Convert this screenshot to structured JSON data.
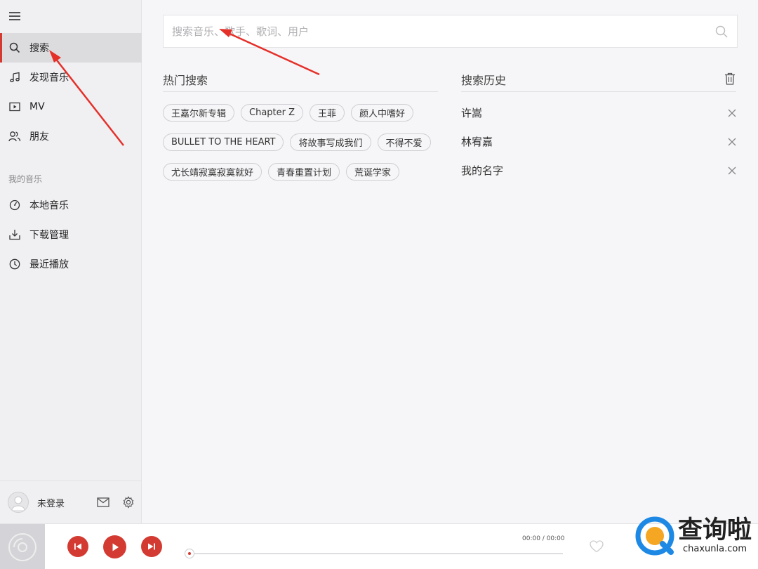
{
  "sidebar": {
    "nav": [
      {
        "label": "搜索",
        "icon": "search-icon",
        "active": true
      },
      {
        "label": "发现音乐",
        "icon": "music-note-icon"
      },
      {
        "label": "MV",
        "icon": "video-icon"
      },
      {
        "label": "朋友",
        "icon": "friends-icon"
      }
    ],
    "my_music_title": "我的音乐",
    "my_music": [
      {
        "label": "本地音乐",
        "icon": "local-music-icon"
      },
      {
        "label": "下载管理",
        "icon": "download-icon"
      },
      {
        "label": "最近播放",
        "icon": "clock-icon"
      }
    ],
    "login_label": "未登录"
  },
  "search": {
    "placeholder": "搜索音乐、歌手、歌词、用户"
  },
  "hot_search": {
    "title": "热门搜索",
    "rows": [
      [
        "王嘉尔新专辑",
        "Chapter Z",
        "王菲",
        "颜人中嗜好"
      ],
      [
        "BULLET TO THE HEART",
        "将故事写成我们",
        "不得不爱"
      ],
      [
        "尤长靖寂寞寂寞就好",
        "青春重置计划",
        "荒诞学家"
      ]
    ]
  },
  "history": {
    "title": "搜索历史",
    "items": [
      "许嵩",
      "林宥嘉",
      "我的名字"
    ]
  },
  "player": {
    "time": "00:00 / 00:00",
    "progress": 0
  },
  "watermark": {
    "cn": "查询啦",
    "en": "chaxunla.com"
  },
  "colors": {
    "accent": "#d33a31",
    "sidebar_bg": "#f0f0f3",
    "main_bg": "#f6f6f8",
    "watermark_blue": "#1e88e5",
    "watermark_orange": "#f5a623"
  }
}
